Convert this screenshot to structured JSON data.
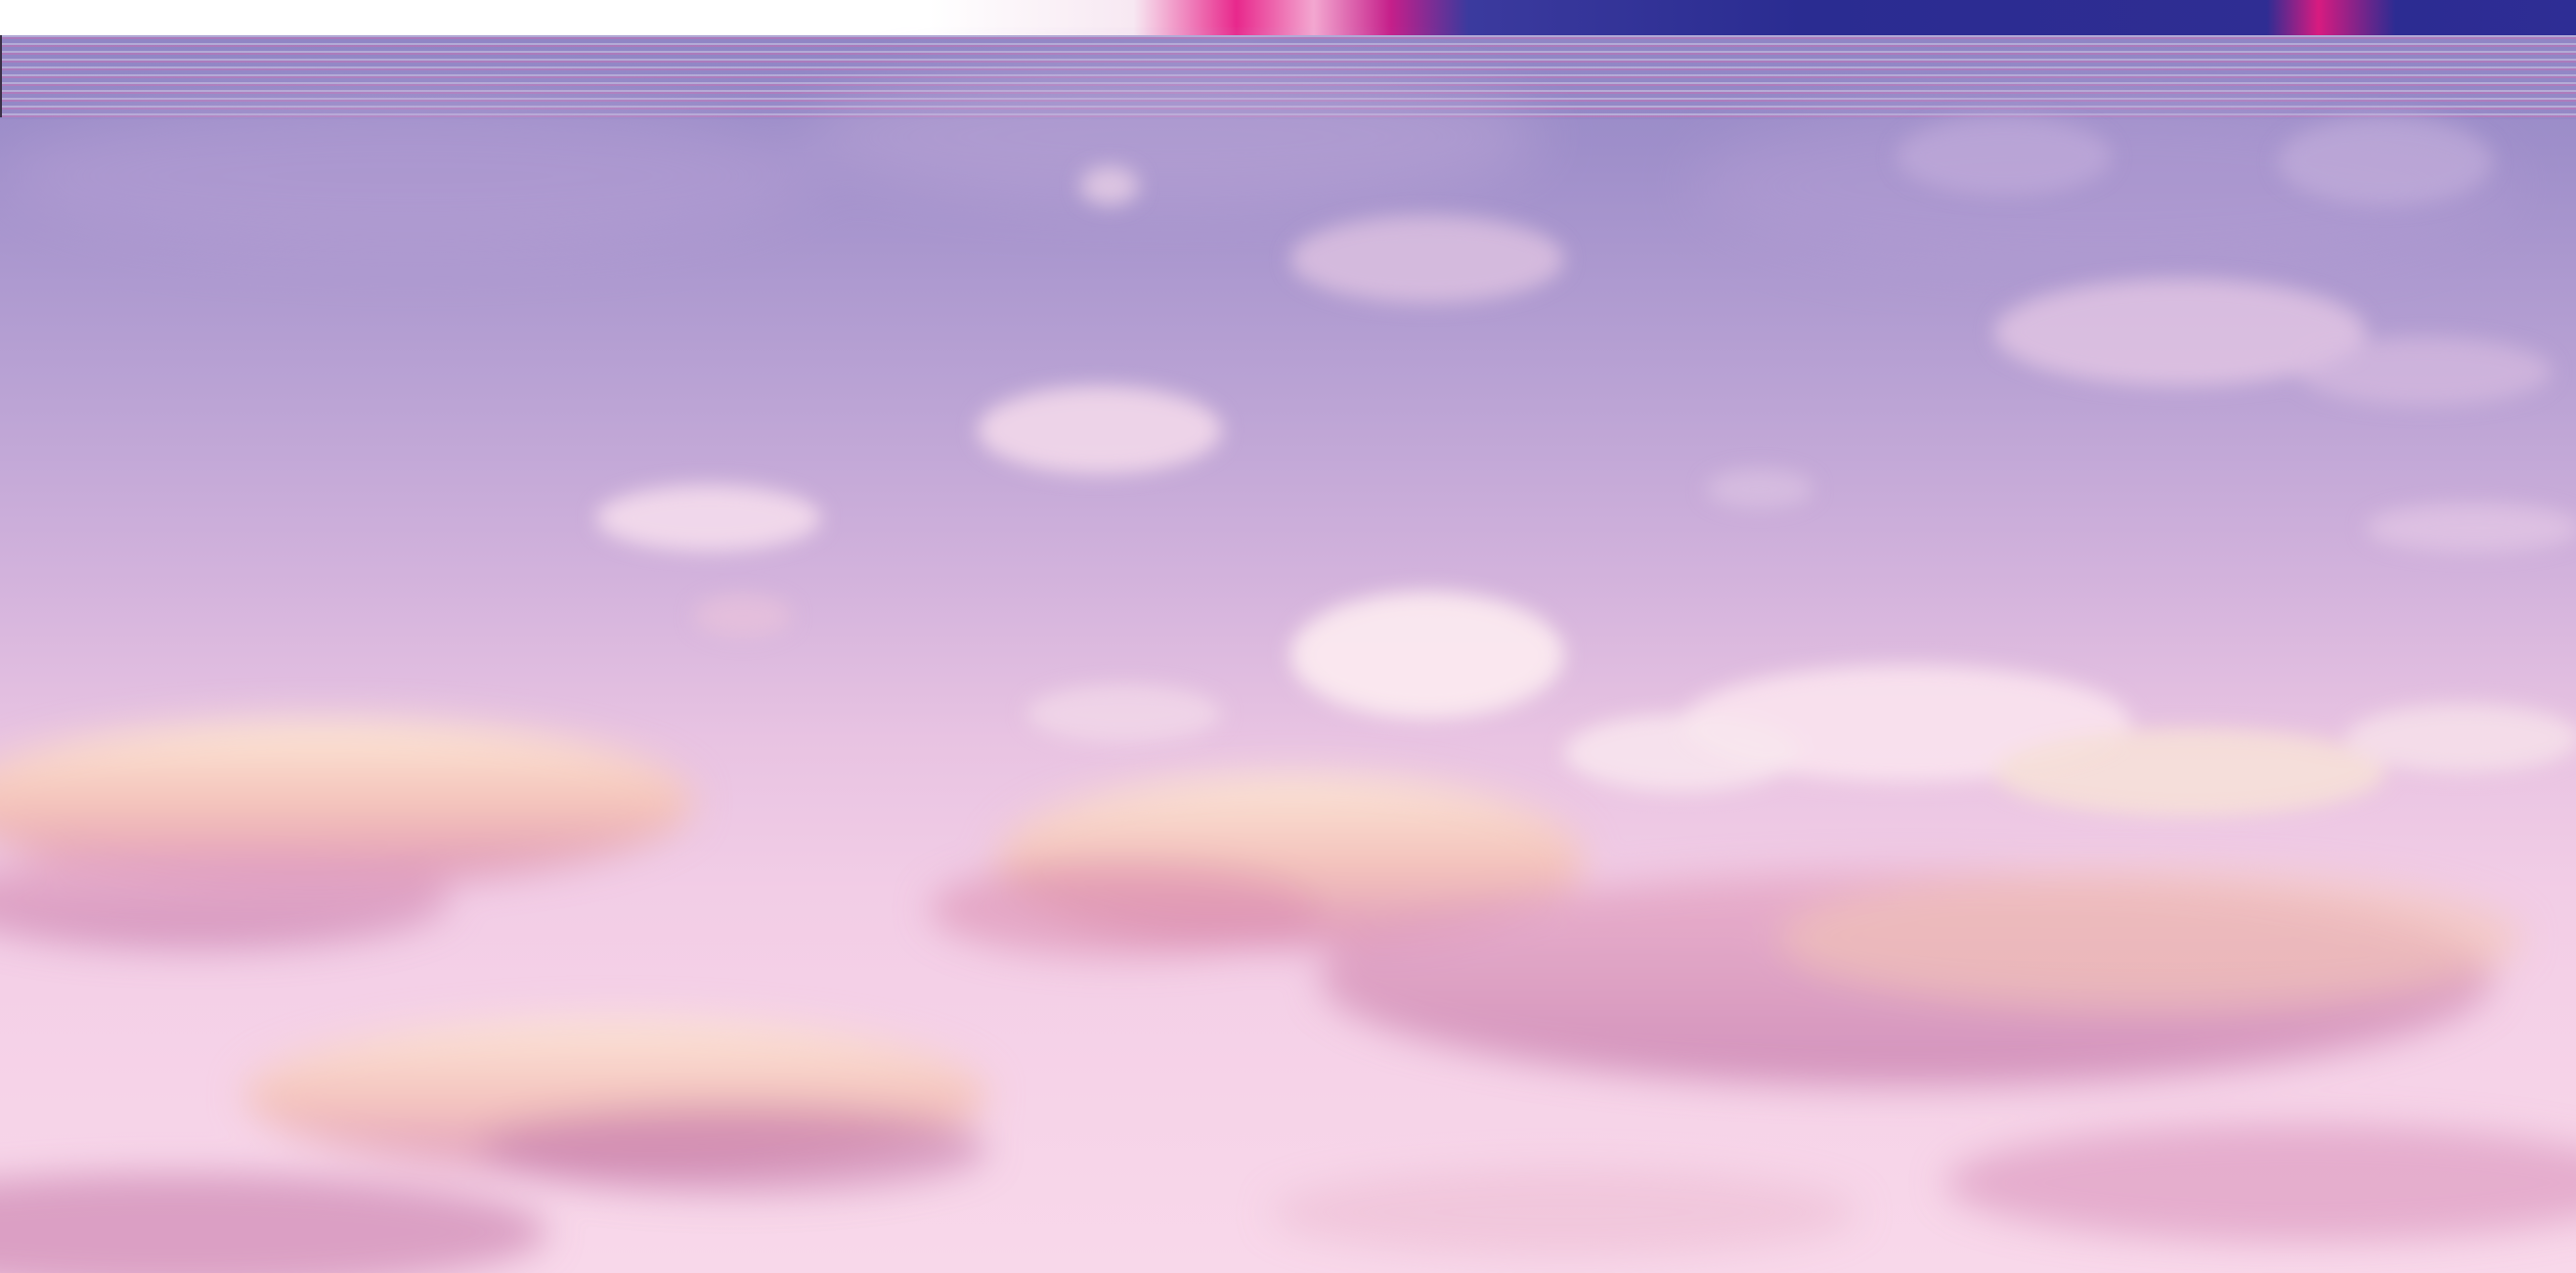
{
  "image": {
    "subject": "sky-with-clouds",
    "palette": {
      "sky_top": "#8f86c4",
      "sky_mid": "#d2b2dc",
      "sky_bottom": "#f8d8ea",
      "cloud_light": "#fbe9ef",
      "cloud_warm": "#f4c9a8",
      "cloud_shadow": "#d98fb8",
      "glitch_magenta": "#e8288c",
      "glitch_navy": "#2c2c92"
    }
  }
}
